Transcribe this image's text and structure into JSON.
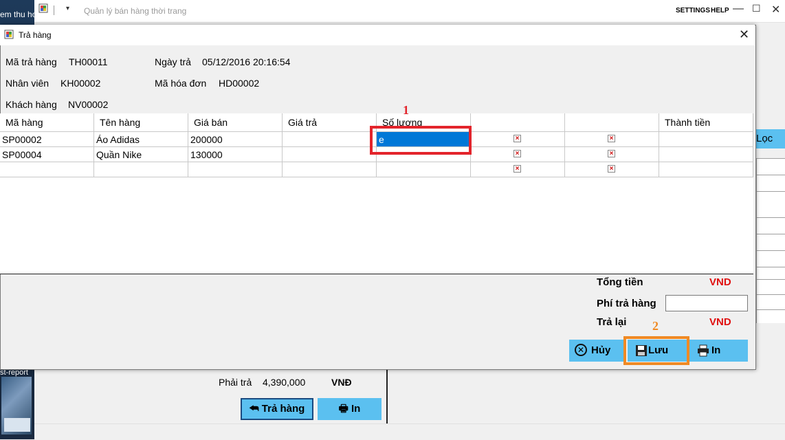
{
  "desktop": {
    "label_top": "em thu ho",
    "label_bottom": "st-report"
  },
  "main_window": {
    "title": "Quản lý bán hàng thời trang",
    "dropdown_glyph": "▾",
    "settings": "SETTINGS",
    "help": "HELP",
    "minimize_glyph": "—",
    "maximize_glyph": "☐",
    "close_glyph": "✕",
    "filter_button": "Lọc",
    "phai_tra_label": "Phải trả",
    "phai_tra_value": "4,390,000",
    "phai_tra_currency": "VNĐ",
    "tra_hang_button": "Trả hàng",
    "in_button": "In"
  },
  "dialog": {
    "title": "Trả hàng",
    "close_glyph": "✕",
    "info": {
      "ma_tra_hang_label": "Mã trả hàng",
      "ma_tra_hang_value": "TH00011",
      "ngay_tra_label": "Ngày trả",
      "ngay_tra_value": "05/12/2016 20:16:54",
      "nhan_vien_label": "Nhân viên",
      "nhan_vien_value": "KH00002",
      "ma_hoa_don_label": "Mã hóa đơn",
      "ma_hoa_don_value": "HD00002",
      "khach_hang_label": "Khách hàng",
      "khach_hang_value": "NV00002"
    },
    "grid": {
      "columns": [
        "Mã hàng",
        "Tên hàng",
        "Giá bán",
        "Giá trả",
        "Số lượng",
        "",
        "",
        "Thành tiền"
      ],
      "rows": [
        {
          "ma_hang": "SP00002",
          "ten_hang": "Áo Adidas",
          "gia_ban": "200000",
          "gia_tra": "",
          "so_luong": "e",
          "thanh_tien": ""
        },
        {
          "ma_hang": "SP00004",
          "ten_hang": "Quần Nike",
          "gia_ban": "130000",
          "gia_tra": "",
          "so_luong": "",
          "thanh_tien": ""
        },
        {
          "ma_hang": "",
          "ten_hang": "",
          "gia_ban": "",
          "gia_tra": "",
          "so_luong": "",
          "thanh_tien": ""
        }
      ],
      "delete_glyph": "×"
    },
    "totals": {
      "tong_tien_label": "Tổng tiền",
      "tong_tien_currency": "VND",
      "phi_tra_hang_label": "Phí trả hàng",
      "phi_tra_hang_value": "",
      "tra_lai_label": "Trả lại",
      "tra_lai_currency": "VND"
    },
    "buttons": {
      "huy": "Hủy",
      "luu": "Lưu",
      "in": "In"
    },
    "annotations": {
      "step1": "1",
      "step2": "2"
    }
  },
  "colors": {
    "accent_button": "#5bc0f0",
    "selection": "#0078d7",
    "annotation_red": "#e3242b",
    "annotation_orange": "#f08a24",
    "currency_red": "#e01010"
  }
}
